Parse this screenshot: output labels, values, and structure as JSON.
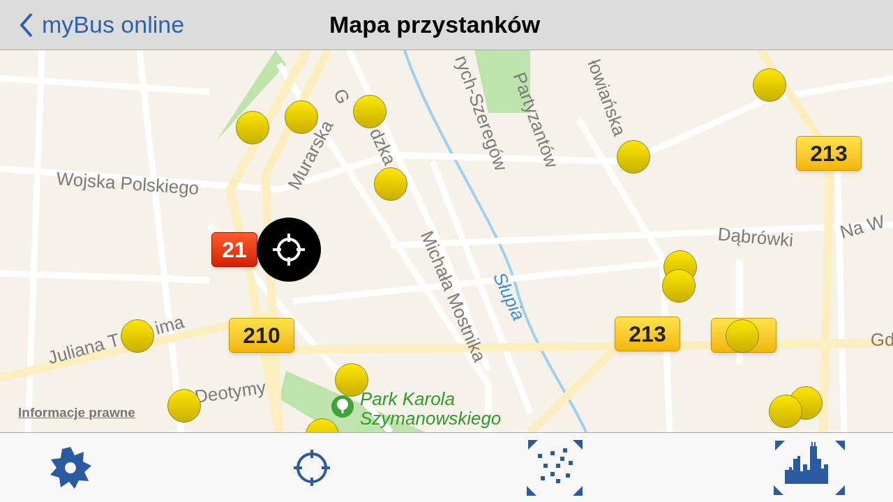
{
  "nav_bar": {
    "back_label": "myBus online",
    "title": "Mapa przystanków"
  },
  "map": {
    "labels": [
      {
        "text": "Wojska Polskiego",
        "kind": "street"
      },
      {
        "text": "Murarska",
        "kind": "street"
      },
      {
        "text": "G",
        "kind": "street"
      },
      {
        "text": "dzka",
        "kind": "street"
      },
      {
        "text": "rych-Szeregów",
        "kind": "street"
      },
      {
        "text": "Partyzantów",
        "kind": "street"
      },
      {
        "text": "łowiańska",
        "kind": "street"
      },
      {
        "text": "Dąbrówki",
        "kind": "street"
      },
      {
        "text": "Na W",
        "kind": "street"
      },
      {
        "text": "Michała Mostnika",
        "kind": "street"
      },
      {
        "text": "Słupia",
        "kind": "river"
      },
      {
        "text": "Juliana T",
        "kind": "street"
      },
      {
        "text": "ima",
        "kind": "street"
      },
      {
        "text": "Deotymy",
        "kind": "street"
      },
      {
        "text": "Park Karola Szymanowskiego",
        "kind": "park"
      },
      {
        "text": "Gd",
        "kind": "street"
      }
    ],
    "route_badges": [
      {
        "text": "213",
        "highlighted": false
      },
      {
        "text": "210",
        "highlighted": false
      },
      {
        "text": "213",
        "highlighted": false
      },
      {
        "highlighted": false
      },
      {
        "text": "21",
        "highlighted": true
      }
    ],
    "legal_link": "Informacje prawne"
  }
}
